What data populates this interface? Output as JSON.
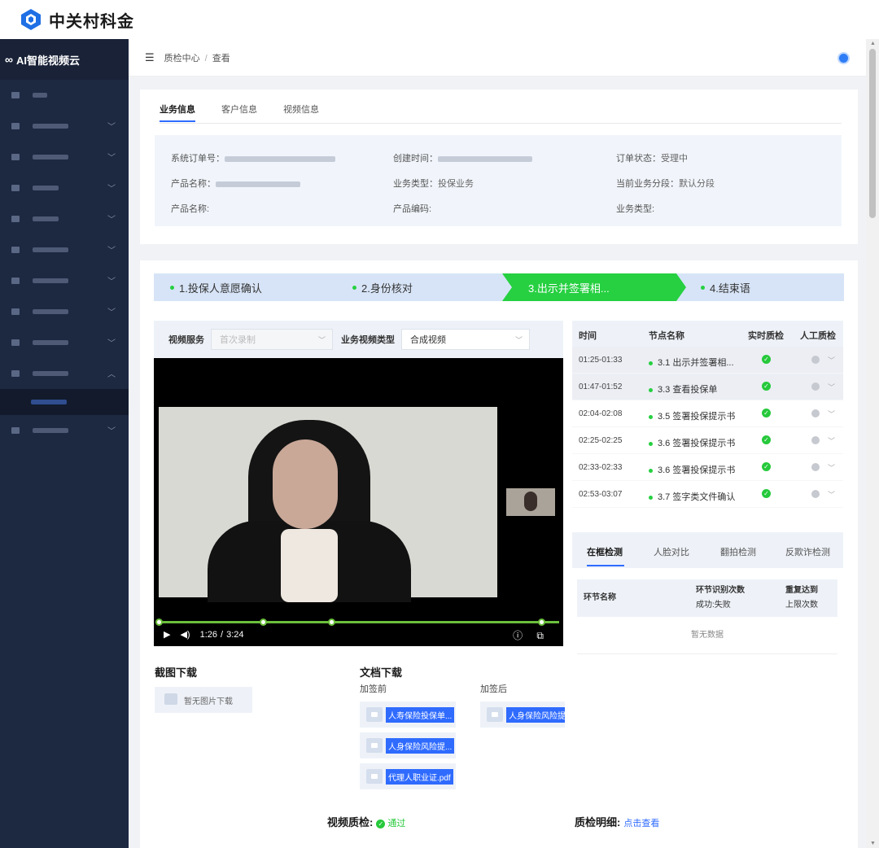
{
  "brand": {
    "name": "中关村科金"
  },
  "sidebar": {
    "app_title": "AI智能视频云",
    "title_icon": "infinity-icon"
  },
  "topbar": {
    "crumb_root": "质检中心",
    "crumb_sep": "/",
    "crumb_current": "查看"
  },
  "info_tabs": [
    "业务信息",
    "客户信息",
    "视频信息"
  ],
  "info": {
    "order_no_label": "系统订单号：",
    "created_label": "创建时间：",
    "order_status_label": "订单状态：",
    "order_status_value": "受理中",
    "product_name_label": "产品名称：",
    "biz_type_label": "业务类型：",
    "biz_type_value": "投保业务",
    "stage_label": "当前业务分段：",
    "stage_value": "默认分段",
    "product_name2_label": "产品名称:",
    "product_code_label": "产品编码:",
    "biz_type2_label": "业务类型:"
  },
  "steps": [
    "1.投保人意愿确认",
    "2.身份核对",
    "3.出示并签署相...",
    "4.结束语"
  ],
  "video_panel": {
    "service_label": "视频服务",
    "service_placeholder": "首次录制",
    "type_label": "业务视频类型",
    "type_value": "合成视频",
    "current_time": "1:26",
    "time_sep": "/",
    "duration": "3:24",
    "progress_fraction": 0.43
  },
  "timeline": {
    "headers": [
      "时间",
      "节点名称",
      "实时质检",
      "人工质检"
    ],
    "rows": [
      {
        "time": "01:25-01:33",
        "name": "3.1 出示并签署相..."
      },
      {
        "time": "01:47-01:52",
        "name": "3.3 查看投保单"
      },
      {
        "time": "02:04-02:08",
        "name": "3.5 签署投保提示书"
      },
      {
        "time": "02:25-02:25",
        "name": "3.6 签署投保提示书"
      },
      {
        "time": "02:33-02:33",
        "name": "3.6 签署投保提示书"
      },
      {
        "time": "02:53-03:07",
        "name": "3.7 签字类文件确认"
      }
    ]
  },
  "detect": {
    "tabs": [
      "在框检测",
      "人脸对比",
      "翻拍检测",
      "反欺诈检测"
    ],
    "col1": "环节名称",
    "col2a": "环节识别次数",
    "col2b": "成功:失败",
    "col3a": "重复达到",
    "col3b": "上限次数",
    "empty": "暂无数据"
  },
  "screenshots": {
    "title": "截图下载",
    "empty": "暂无图片下载"
  },
  "docs": {
    "title": "文档下载",
    "before_label": "加签前",
    "after_label": "加签后",
    "before_files": [
      "人寿保险投保单...",
      "人身保险风险提...",
      "代理人职业证.pdf"
    ],
    "after_files": [
      "人身保险风险提..."
    ]
  },
  "video_qc": {
    "label": "视频质检:",
    "result": "通过"
  },
  "qc_detail": {
    "label": "质检明细:",
    "link": "点击查看"
  }
}
